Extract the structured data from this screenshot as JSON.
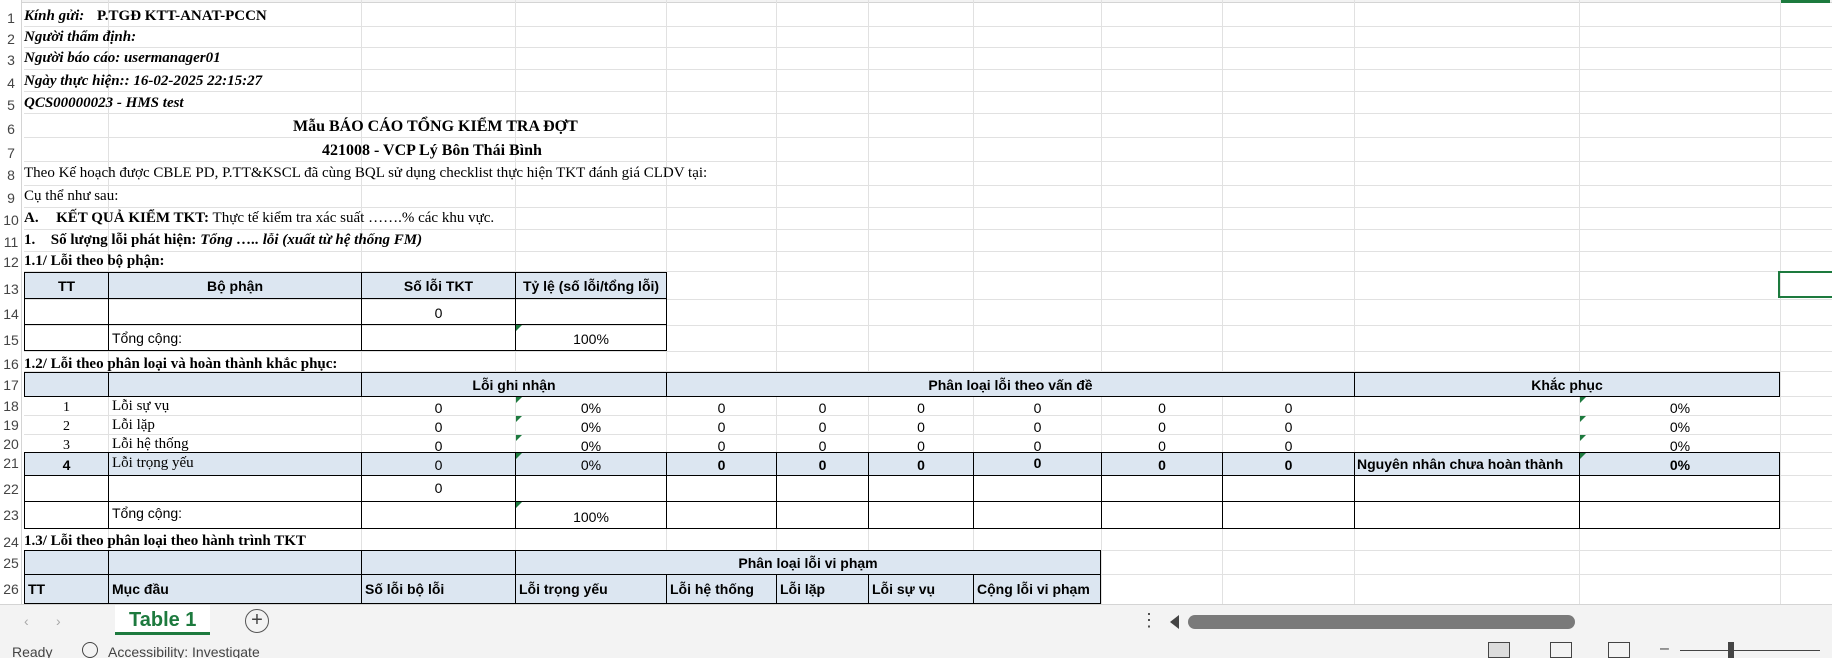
{
  "sheet": {
    "row_numbers": [
      "1",
      "2",
      "3",
      "4",
      "5",
      "6",
      "7",
      "8",
      "9",
      "10",
      "11",
      "12",
      "13",
      "14",
      "15",
      "16",
      "17",
      "18",
      "19",
      "20",
      "21",
      "22",
      "23",
      "24",
      "25",
      "26"
    ],
    "r1_label": "Kính gửi:",
    "r1_value": "P.TGĐ KTT-ANAT-PCCN",
    "r2": "Người thẩm định:",
    "r3": "Người báo cáo: usermanager01",
    "r4": "Ngày thực hiện:: 16-02-2025 22:15:27",
    "r5": "QCS00000023 - HMS test",
    "r6": "Mẫu BÁO CÁO TỔNG KIỂM TRA ĐỢT",
    "r7": "421008 - VCP Lý Bôn Thái Bình",
    "r8": "Theo Kế hoạch được CBLE PD, P.TT&KSCL đã cùng BQL sử dụng checklist thực hiện TKT đánh giá CLDV tại:",
    "r9": "Cụ thể như sau:",
    "r10_prefix": "A.",
    "r10_bold": "KẾT QUẢ KIỂM TKT:",
    "r10_rest": "Thực tế kiểm tra xác suất …….% các khu vực.",
    "r11_prefix": "1.",
    "r11_bold": "Số lượng lỗi phát hiện:",
    "r11_italic": "Tổng ….. lỗi (xuất từ hệ thống FM)",
    "r12": "1.1/ Lỗi theo bộ phận:",
    "t1": {
      "h_tt": "TT",
      "h_bophan": "Bộ phận",
      "h_soloi": "Số lỗi TKT",
      "h_tyle": "Tỷ lệ (số lỗi/tổng lỗi)",
      "r14_soloi": "0",
      "r15_label": "Tổng cộng:",
      "r15_tyle": "100%"
    },
    "r16": "1.2/ Lỗi theo phân loại và hoàn thành khắc phục:",
    "t2": {
      "h_loighinhan": "Lỗi ghi nhận",
      "h_phanloai": "Phân loại lỗi theo vấn đề",
      "h_khacphuc": "Khắc phục",
      "rows": [
        {
          "tt": "1",
          "name": "Lỗi sự vụ",
          "count": "0",
          "pct": "0%",
          "c1": "0",
          "c2": "0",
          "c3": "0",
          "c4": "0",
          "c5": "0",
          "c6": "0",
          "fix": "0%"
        },
        {
          "tt": "2",
          "name": "Lỗi lặp",
          "count": "0",
          "pct": "0%",
          "c1": "0",
          "c2": "0",
          "c3": "0",
          "c4": "0",
          "c5": "0",
          "c6": "0",
          "fix": "0%"
        },
        {
          "tt": "3",
          "name": "Lỗi hệ thống",
          "count": "0",
          "pct": "0%",
          "c1": "0",
          "c2": "0",
          "c3": "0",
          "c4": "0",
          "c5": "0",
          "c6": "0",
          "fix": "0%"
        },
        {
          "tt": "4",
          "name": "Lỗi trọng yếu",
          "count": "0",
          "pct": "0%",
          "c1": "0",
          "c2": "0",
          "c3": "0",
          "c4": "0",
          "c5": "0",
          "c6": "0",
          "fix": "0%"
        }
      ],
      "r21_reason": "Nguyên nhân chưa hoàn thành",
      "r22_count": "0",
      "r23_label": "Tổng cộng:",
      "r23_pct": "100%"
    },
    "r24": "1.3/ Lỗi theo phân loại theo hành trình TKT",
    "t3": {
      "h_group": "Phân loại lỗi vi phạm",
      "h_tt": "TT",
      "h_mucdau": "Mục đầu",
      "h_soloi": "Số lỗi bộ lỗi",
      "h_trongyeu": "Lỗi trọng yếu",
      "h_hethong": "Lỗi hệ thống",
      "h_lap": "Lỗi lặp",
      "h_suvu": "Lỗi sự vụ",
      "h_cong": "Cộng lỗi vi phạm"
    }
  },
  "tabs": {
    "sheet_name": "Table 1",
    "add_symbol": "+",
    "dots": "⋮",
    "prev": "‹",
    "next": "›"
  },
  "status": {
    "ready": "Ready",
    "accessibility": "Accessibility: Investigate",
    "zoom_minus": "–"
  },
  "colors": {
    "accent": "#1d7a3e",
    "header_fill": "#dce6f1"
  },
  "icons": [
    "accessibility-icon",
    "normal-view-icon",
    "page-layout-icon",
    "page-break-icon",
    "add-sheet-icon"
  ]
}
